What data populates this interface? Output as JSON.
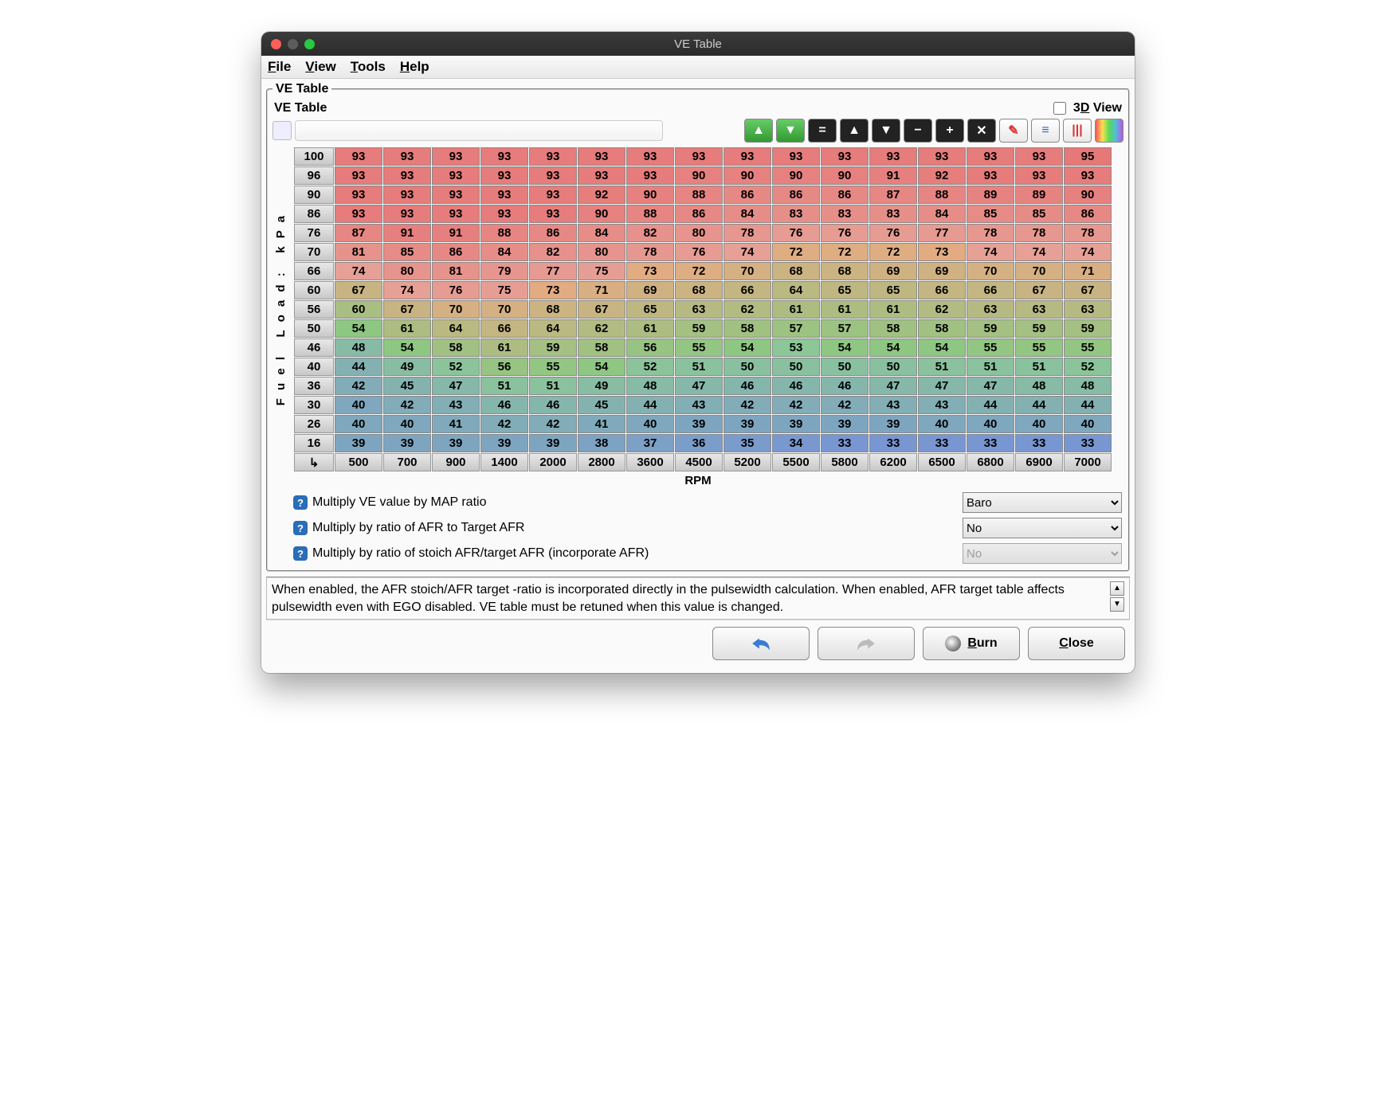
{
  "window_title": "VE Table",
  "menu": {
    "file": "File",
    "view": "View",
    "tools": "Tools",
    "help": "Help"
  },
  "group_title": "VE Table",
  "sub_title": "VE Table",
  "threeD_label": "3D View",
  "y_axis_label": "Fuel Load: kPa",
  "x_axis_label": "RPM",
  "y_headers": [
    100,
    96,
    90,
    86,
    76,
    70,
    66,
    60,
    56,
    50,
    46,
    40,
    36,
    30,
    26,
    16
  ],
  "x_headers": [
    500,
    700,
    900,
    1400,
    2000,
    2800,
    3600,
    4500,
    5200,
    5500,
    5800,
    6200,
    6500,
    6800,
    6900,
    7000
  ],
  "cells": [
    [
      93,
      93,
      93,
      93,
      93,
      93,
      93,
      93,
      93,
      93,
      93,
      93,
      93,
      93,
      93,
      95
    ],
    [
      93,
      93,
      93,
      93,
      93,
      93,
      93,
      90,
      90,
      90,
      90,
      91,
      92,
      93,
      93,
      93
    ],
    [
      93,
      93,
      93,
      93,
      93,
      92,
      90,
      88,
      86,
      86,
      86,
      87,
      88,
      89,
      89,
      90
    ],
    [
      93,
      93,
      93,
      93,
      93,
      90,
      88,
      86,
      84,
      83,
      83,
      83,
      84,
      85,
      85,
      86
    ],
    [
      87,
      91,
      91,
      88,
      86,
      84,
      82,
      80,
      78,
      76,
      76,
      76,
      77,
      78,
      78,
      78
    ],
    [
      81,
      85,
      86,
      84,
      82,
      80,
      78,
      76,
      74,
      72,
      72,
      72,
      73,
      74,
      74,
      74
    ],
    [
      74,
      80,
      81,
      79,
      77,
      75,
      73,
      72,
      70,
      68,
      68,
      69,
      69,
      70,
      70,
      71
    ],
    [
      67,
      74,
      76,
      75,
      73,
      71,
      69,
      68,
      66,
      64,
      65,
      65,
      66,
      66,
      67,
      67
    ],
    [
      60,
      67,
      70,
      70,
      68,
      67,
      65,
      63,
      62,
      61,
      61,
      61,
      62,
      63,
      63,
      63
    ],
    [
      54,
      61,
      64,
      66,
      64,
      62,
      61,
      59,
      58,
      57,
      57,
      58,
      58,
      59,
      59,
      59
    ],
    [
      48,
      54,
      58,
      61,
      59,
      58,
      56,
      55,
      54,
      53,
      54,
      54,
      54,
      55,
      55,
      55
    ],
    [
      44,
      49,
      52,
      56,
      55,
      54,
      52,
      51,
      50,
      50,
      50,
      50,
      51,
      51,
      51,
      52
    ],
    [
      42,
      45,
      47,
      51,
      51,
      49,
      48,
      47,
      46,
      46,
      46,
      47,
      47,
      47,
      48,
      48
    ],
    [
      40,
      42,
      43,
      46,
      46,
      45,
      44,
      43,
      42,
      42,
      42,
      43,
      43,
      44,
      44,
      44
    ],
    [
      40,
      40,
      41,
      42,
      42,
      41,
      40,
      39,
      39,
      39,
      39,
      39,
      40,
      40,
      40,
      40
    ],
    [
      39,
      39,
      39,
      39,
      39,
      38,
      37,
      36,
      35,
      34,
      33,
      33,
      33,
      33,
      33,
      33
    ]
  ],
  "options": [
    {
      "label": "Multiply VE value by MAP ratio",
      "value": "Baro",
      "disabled": false
    },
    {
      "label": "Multiply by ratio of AFR to Target AFR",
      "value": "No",
      "disabled": false
    },
    {
      "label": "Multiply by ratio of stoich AFR/target AFR (incorporate AFR)",
      "value": "No",
      "disabled": true
    }
  ],
  "help_text": "When enabled, the AFR stoich/AFR target -ratio is incorporated directly in the pulsewidth calculation. When enabled, AFR target table affects pulsewidth even with EGO disabled. VE table must be retuned when this value is changed.",
  "buttons": {
    "burn": "Burn",
    "close": "Close"
  },
  "toolbar_icons": [
    "green-up",
    "green-down",
    "equals",
    "arrow-up",
    "arrow-down",
    "minus",
    "plus",
    "multiply",
    "pencil",
    "rows",
    "cols",
    "rainbow"
  ]
}
